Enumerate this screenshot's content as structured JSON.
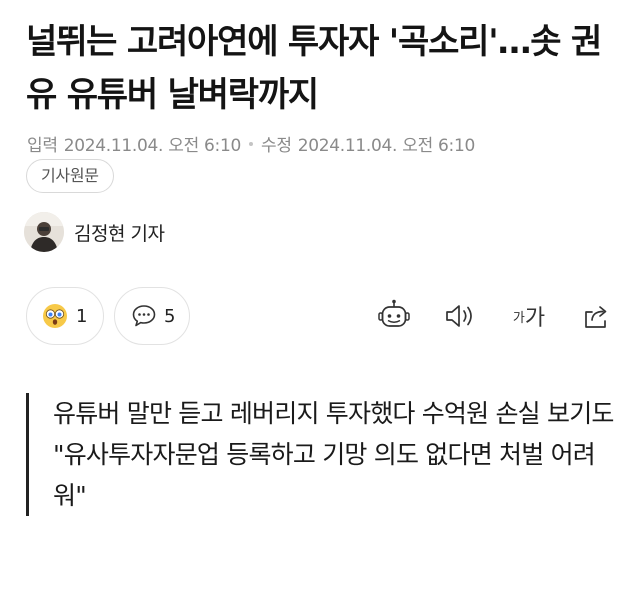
{
  "article": {
    "headline": "널뛰는 고려아연에 투자자 '곡소리'…솟 권유 유튜버 날벼락까지",
    "meta": {
      "published_label": "입력",
      "published_time": "2024.11.04. 오전 6:10",
      "updated_label": "수정",
      "updated_time": "2024.11.04. 오전 6:10"
    },
    "original_button_label": "기사원문",
    "reporter": "김정현 기자",
    "reactions": {
      "reaction_count": "1",
      "comment_count": "5"
    },
    "toolbar": {
      "font_small": "가",
      "font_large": "가"
    },
    "subheads": [
      "유튜버 말만 듣고 레버리지 투자했다 수억원 손실 보기도",
      "\"유사투자자문업 등록하고 기망 의도 없다면 처벌 어려워\""
    ]
  }
}
